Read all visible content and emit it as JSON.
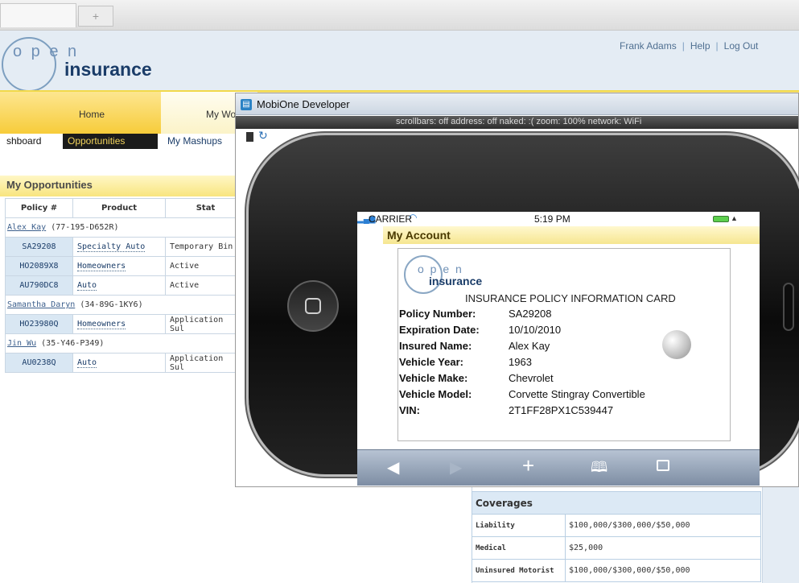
{
  "browser": {
    "new_tab_glyph": "+"
  },
  "app": {
    "logo_open": "o p e n",
    "logo_insurance": "insurance",
    "user_name": "Frank Adams",
    "help_link": "Help",
    "logout_link": "Log Out",
    "sep": "|",
    "nav_home": "Home",
    "nav_mywork": "My Wo",
    "sub_dashboard": "shboard",
    "sub_opportunities": "Opportunities",
    "sub_mashups": "My Mashups",
    "opps_title": "My Opportunities",
    "opps_columns": [
      "Policy #",
      "Product",
      "Stat"
    ],
    "opps_rows": [
      {
        "customer": "Alex Kay",
        "customer_id": "(77-195-D652R)"
      },
      {
        "policy": "SA29208",
        "product": "Specialty Auto",
        "status": "Temporary Bin"
      },
      {
        "policy": "HO2089X8",
        "product": "Homeowners",
        "status": "Active"
      },
      {
        "policy": "AU790DC8",
        "product": "Auto",
        "status": "Active"
      },
      {
        "customer": "Samantha Daryn",
        "customer_id": "(34-89G-1KY6)"
      },
      {
        "policy": "HO23980Q",
        "product": "Homeowners",
        "status": "Application Sul"
      },
      {
        "customer": "Jin Wu",
        "customer_id": "(35-Y46-P349)"
      },
      {
        "policy": "AU0238Q",
        "product": "Auto",
        "status": "Application Sul"
      }
    ],
    "coverages_title": "Coverages",
    "coverages": [
      {
        "label": "Liability",
        "value": "$100,000/$300,000/$50,000"
      },
      {
        "label": "Medical",
        "value": "$25,000"
      },
      {
        "label": "Uninsured Motorist",
        "value": "$100,000/$300,000/$50,000"
      }
    ]
  },
  "mobione": {
    "title": "MobiOne Developer",
    "status_line": "scrollbars: off   address: off   naked: :(   zoom: 100%   network: WiFi",
    "phone": {
      "carrier": "CARRIER",
      "time": "5:19 PM",
      "account_title": "My Account",
      "card_logo_open": "o p e n",
      "card_logo_insurance": "insurance",
      "card_title": "INSURANCE POLICY INFORMATION CARD",
      "fields": [
        {
          "label": "Policy Number:",
          "value": "SA29208"
        },
        {
          "label": "Expiration Date:",
          "value": "10/10/2010"
        },
        {
          "label": "Insured Name:",
          "value": "Alex Kay"
        },
        {
          "label": "Vehicle Year:",
          "value": "1963"
        },
        {
          "label": "Vehicle Make:",
          "value": "Chevrolet"
        },
        {
          "label": "Vehicle Model:",
          "value": "Corvette Stingray Convertible"
        },
        {
          "label": "VIN:",
          "value": "2T1FF28PX1C539447"
        }
      ],
      "toolbar": {
        "back_glyph": "◀",
        "forward_glyph": "▶",
        "add_glyph": "+",
        "bookmarks_glyph": "🕮"
      }
    }
  },
  "icons": [
    "new-tab-icon",
    "mobione-app-icon",
    "device-icon",
    "rotate-icon",
    "signal-icon",
    "wifi-icon",
    "battery-icon",
    "back-icon",
    "forward-icon",
    "add-icon",
    "bookmarks-icon",
    "pages-icon",
    "home-button-icon"
  ]
}
